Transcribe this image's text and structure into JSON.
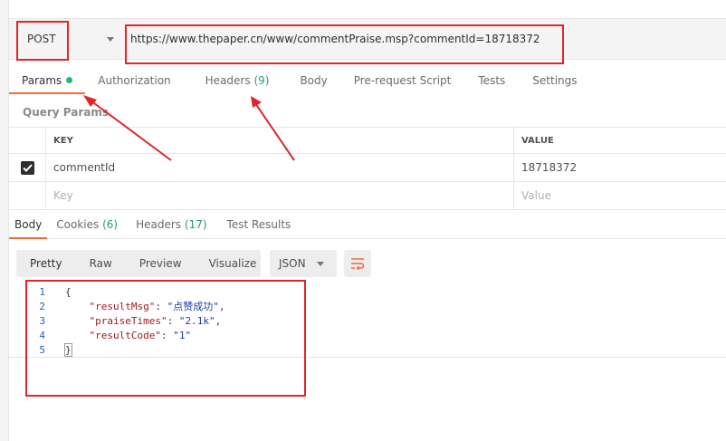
{
  "request": {
    "method": "POST",
    "url": "https://www.thepaper.cn/www/commentPraise.msp?commentId=18718372"
  },
  "req_tabs": [
    {
      "label": "Params",
      "badge": ""
    },
    {
      "label": "Authorization",
      "badge": ""
    },
    {
      "label": "Headers",
      "badge": "(9)"
    },
    {
      "label": "Body",
      "badge": ""
    },
    {
      "label": "Pre-request Script",
      "badge": ""
    },
    {
      "label": "Tests",
      "badge": ""
    },
    {
      "label": "Settings",
      "badge": ""
    }
  ],
  "query_params": {
    "title": "Query Params",
    "headers": {
      "key": "KEY",
      "value": "VALUE"
    },
    "rows": [
      {
        "key": "commentId",
        "value": "18718372",
        "checked": true
      }
    ],
    "placeholder": {
      "key": "Key",
      "value": "Value"
    }
  },
  "resp_tabs": [
    {
      "label": "Body",
      "badge": ""
    },
    {
      "label": "Cookies",
      "badge": "(6)"
    },
    {
      "label": "Headers",
      "badge": "(17)"
    },
    {
      "label": "Test Results",
      "badge": ""
    }
  ],
  "view": {
    "options": [
      "Pretty",
      "Raw",
      "Preview",
      "Visualize"
    ],
    "format": "JSON"
  },
  "response": {
    "lines": [
      {
        "n": "1",
        "open": "{"
      },
      {
        "n": "2",
        "key": "\"resultMsg\"",
        "val": "\"点赞成功\"",
        "comma": ","
      },
      {
        "n": "3",
        "key": "\"praiseTimes\"",
        "val": "\"2.1k\"",
        "comma": ","
      },
      {
        "n": "4",
        "key": "\"resultCode\"",
        "val": "\"1\"",
        "comma": ""
      },
      {
        "n": "5",
        "close": "}"
      }
    ]
  },
  "colors": {
    "accent": "#f26b3a",
    "annotation": "#e0262b",
    "success": "#26b47f"
  }
}
